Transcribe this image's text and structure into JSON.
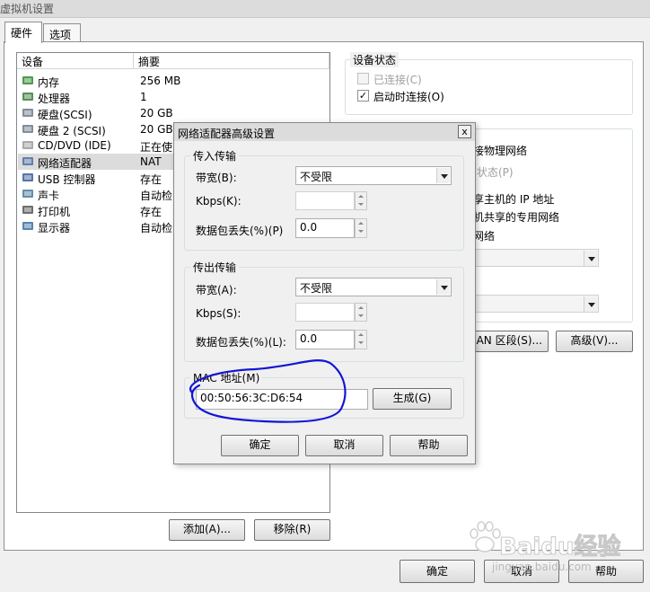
{
  "window": {
    "title": "虚拟机设置"
  },
  "tabs": [
    {
      "label": "硬件"
    },
    {
      "label": "选项"
    }
  ],
  "device_list": {
    "headers": [
      "设备",
      "摘要"
    ],
    "rows": [
      {
        "device": "内存",
        "summary": "256 MB",
        "icon": "memory-icon"
      },
      {
        "device": "处理器",
        "summary": "1",
        "icon": "processor-icon"
      },
      {
        "device": "硬盘(SCSI)",
        "summary": "20 GB",
        "icon": "hard-disk-icon"
      },
      {
        "device": "硬盘 2 (SCSI)",
        "summary": "20 GB",
        "icon": "hard-disk-icon"
      },
      {
        "device": "CD/DVD (IDE)",
        "summary": "正在使",
        "icon": "cd-dvd-icon"
      },
      {
        "device": "网络适配器",
        "summary": "NAT",
        "icon": "network-adapter-icon"
      },
      {
        "device": "USB 控制器",
        "summary": "存在",
        "icon": "usb-icon"
      },
      {
        "device": "声卡",
        "summary": "自动检",
        "icon": "sound-card-icon"
      },
      {
        "device": "打印机",
        "summary": "存在",
        "icon": "printer-icon"
      },
      {
        "device": "显示器",
        "summary": "自动检",
        "icon": "display-icon"
      }
    ]
  },
  "list_buttons": {
    "add": "添加(A)...",
    "remove": "移除(R)"
  },
  "device_status": {
    "title": "设备状态",
    "connected": "已连接(C)",
    "connect_at_power_on": "启动时连接(O)"
  },
  "network_connection_partial": {
    "bridged": "接物理网络",
    "replicate_state": "状态(P)",
    "nat": "享主机的 IP 地址",
    "host_only": "机共享的专用网络",
    "custom": "网络",
    "lan_segments_button": "AN 区段(S)...",
    "advanced_button": "高级(V)..."
  },
  "footer": {
    "ok": "确定",
    "cancel": "取消",
    "help": "帮助"
  },
  "watermark": {
    "brand": "Baidu经验",
    "url": "jingyan.baidu.com"
  },
  "dialog": {
    "title": "网络适配器高级设置",
    "incoming": {
      "title": "传入传输",
      "bandwidth_label": "带宽(B):",
      "bandwidth_value": "不受限",
      "kbps_label": "Kbps(K):",
      "kbps_value": "",
      "loss_label": "数据包丢失(%)(P)",
      "loss_value": "0.0"
    },
    "outgoing": {
      "title": "传出传输",
      "bandwidth_label": "带宽(A):",
      "bandwidth_value": "不受限",
      "kbps_label": "Kbps(S):",
      "kbps_value": "",
      "loss_label": "数据包丢失(%)(L):",
      "loss_value": "0.0"
    },
    "mac": {
      "title": "MAC 地址(M)",
      "value": "00:50:56:3C:D6:54",
      "generate": "生成(G)"
    },
    "buttons": {
      "ok": "确定",
      "cancel": "取消",
      "help": "帮助"
    },
    "close_glyph": "x"
  },
  "colors": {
    "annotation": "#1515d6",
    "selection": "#dcdcdc"
  }
}
